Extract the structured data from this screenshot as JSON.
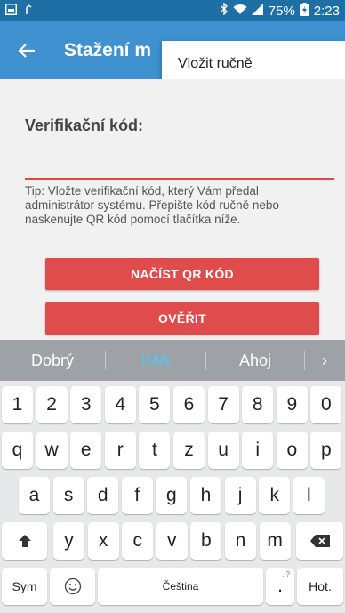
{
  "status_bar": {
    "battery": "75%",
    "time": "2:23"
  },
  "app_bar": {
    "title": "Stažení m"
  },
  "popup": {
    "item": "Vložit ručně"
  },
  "form": {
    "label": "Verifikační kód:",
    "code_value": "",
    "tip": "Tip: Vložte verifikační kód, který Vám předal administrátor systému. Přepište kód ručně nebo naskenujte QR kód pomocí tlačítka níže.",
    "scan_qr_label": "NAČÍST QR KÓD",
    "verify_label": "OVĚŘIT"
  },
  "colors": {
    "status_bar": "#1e6fa6",
    "app_bar": "#3f92cf",
    "accent_red": "#e04b4b",
    "content_bg": "#f1f1f1",
    "keyboard_bg": "#e7e8ea",
    "suggestion_active": "#56c6f2"
  },
  "keyboard": {
    "suggestions": [
      "Dobrý",
      "IMA",
      "Ahoj"
    ],
    "suggestion_more": "›",
    "row_numbers": [
      "1",
      "2",
      "3",
      "4",
      "5",
      "6",
      "7",
      "8",
      "9",
      "0"
    ],
    "row_q": [
      "q",
      "w",
      "e",
      "r",
      "t",
      "z",
      "u",
      "i",
      "o",
      "p"
    ],
    "row_a": [
      "a",
      "s",
      "d",
      "f",
      "g",
      "h",
      "j",
      "k",
      "l"
    ],
    "row_y": [
      "y",
      "x",
      "c",
      "v",
      "b",
      "n",
      "m"
    ],
    "sym_label": "Sym",
    "space_label": "Čeština",
    "period_label": ".",
    "period_hint": "..?",
    "done_label": "Hot.",
    "shift_icon": "shift-arrow-icon",
    "backspace_icon": "backspace-icon",
    "emoji_icon": "emoji-smiley-icon"
  }
}
